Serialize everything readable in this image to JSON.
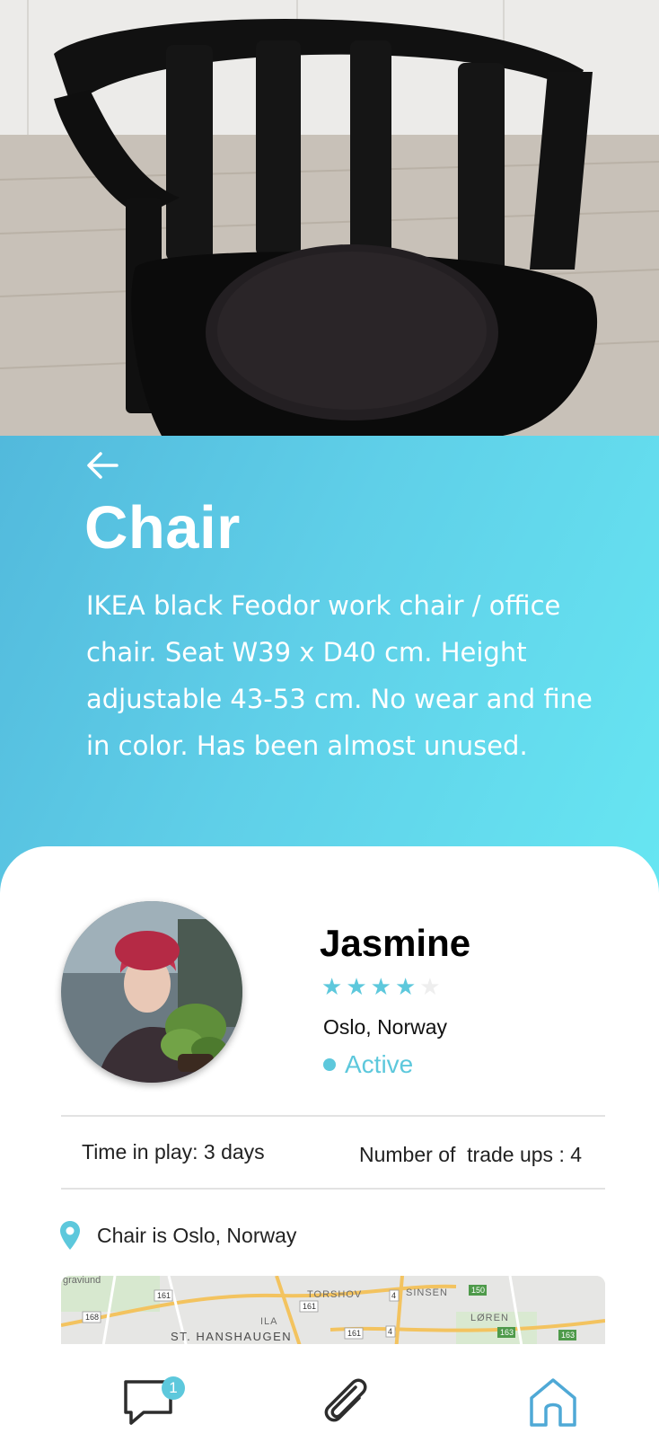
{
  "item": {
    "title": "Chair",
    "description": "IKEA black Feodor work chair / office chair. Seat W39 x D40 cm. Height adjustable 43-53 cm. No wear and fine in color. Has been almost unused."
  },
  "seller": {
    "name": "Jasmine",
    "rating": 4,
    "rating_max": 5,
    "location": "Oslo, Norway",
    "status": "Active"
  },
  "stats": {
    "time_in_play": "Time in play: 3 days",
    "trade_ups": "Number of  trade ups : 4"
  },
  "item_location": {
    "text": "Chair is Oslo, Norway"
  },
  "map": {
    "labels": [
      "graviund",
      "TORSHOV",
      "SINSEN",
      "LØREN",
      "ILA",
      "ST. HANSHAUGEN",
      "168",
      "161",
      "161",
      "161",
      "4",
      "4",
      "150",
      "163",
      "163"
    ]
  },
  "nav": {
    "chat_badge": "1",
    "items": [
      "chat-icon",
      "paperclip-icon",
      "home-icon"
    ]
  },
  "colors": {
    "accent": "#5dc8dc",
    "panel_gradient_start": "#52b9dc",
    "panel_gradient_end": "#67e6f2"
  }
}
